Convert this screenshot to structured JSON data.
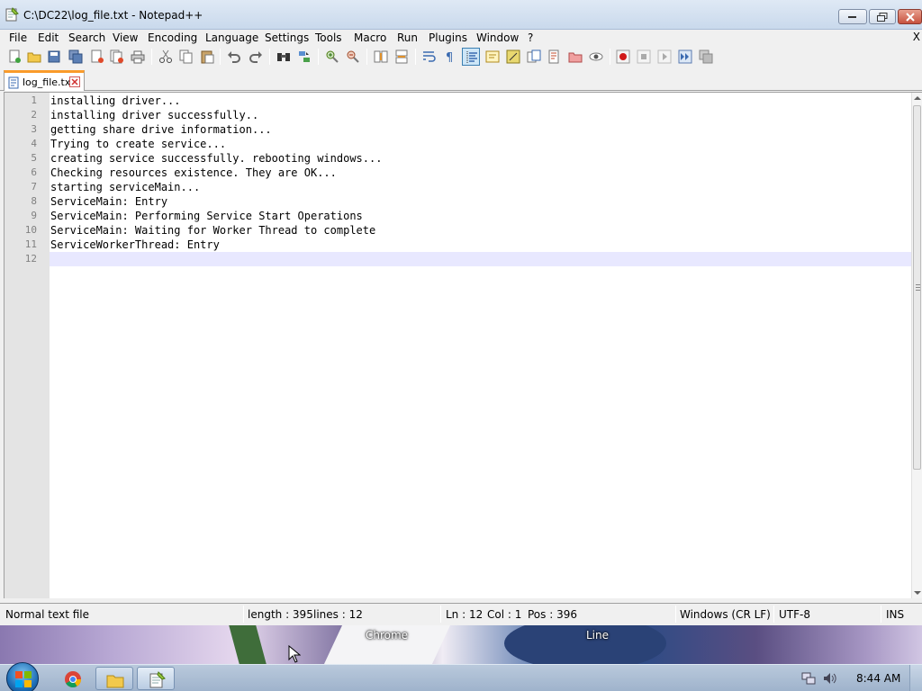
{
  "window": {
    "title": "C:\\DC22\\log_file.txt - Notepad++"
  },
  "menu": {
    "items": [
      "File",
      "Edit",
      "Search",
      "View",
      "Encoding",
      "Language",
      "Settings",
      "Tools",
      "Macro",
      "Run",
      "Plugins",
      "Window",
      "?"
    ],
    "close_glyph": "X"
  },
  "toolbar": {
    "icons": [
      "new-file-icon",
      "open-file-icon",
      "save-icon",
      "save-all-icon",
      "close-icon",
      "close-all-icon",
      "print-icon",
      "cut-icon",
      "copy-icon",
      "paste-icon",
      "undo-icon",
      "redo-icon",
      "find-icon",
      "replace-icon",
      "zoom-in-icon",
      "zoom-out-icon",
      "sync-vertical-icon",
      "sync-horizontal-icon",
      "word-wrap-icon",
      "show-all-chars-icon",
      "indent-guide-icon",
      "user-language-icon",
      "function-list-icon",
      "folder-as-workspace-icon",
      "document-map-icon",
      "document-list-icon",
      "monitoring-icon",
      "record-macro-icon",
      "stop-macro-icon",
      "play-macro-icon",
      "run-macro-multiple-icon",
      "save-macro-icon"
    ]
  },
  "tabs": [
    {
      "label": "log_file.txt",
      "active": true
    }
  ],
  "editor": {
    "lines": [
      "installing driver...",
      "installing driver successfully..",
      "getting share drive information...",
      "Trying to create service...",
      "creating service successfully. rebooting windows...",
      "Checking resources existence. They are OK...",
      "starting serviceMain...",
      "ServiceMain: Entry",
      "ServiceMain: Performing Service Start Operations",
      "ServiceMain: Waiting for Worker Thread to complete",
      "ServiceWorkerThread: Entry",
      ""
    ],
    "line_numbers": [
      "1",
      "2",
      "3",
      "4",
      "5",
      "6",
      "7",
      "8",
      "9",
      "10",
      "11",
      "12"
    ],
    "current_line": 12
  },
  "status": {
    "file_type": "Normal text file",
    "length": "length : 395",
    "lines": "lines : 12",
    "ln": "Ln : 12",
    "col": "Col : 1",
    "pos": "Pos : 396",
    "eol": "Windows (CR LF)",
    "encoding": "UTF-8",
    "mode": "INS"
  },
  "desktop": {
    "labels": [
      "Chrome",
      "Line"
    ]
  },
  "taskbar": {
    "clock": "8:44 AM"
  },
  "colors": {
    "current_line_highlight": "#e8e8ff",
    "active_tab_accent": "#fa9b2a",
    "gutter": "#e4e4e4"
  }
}
